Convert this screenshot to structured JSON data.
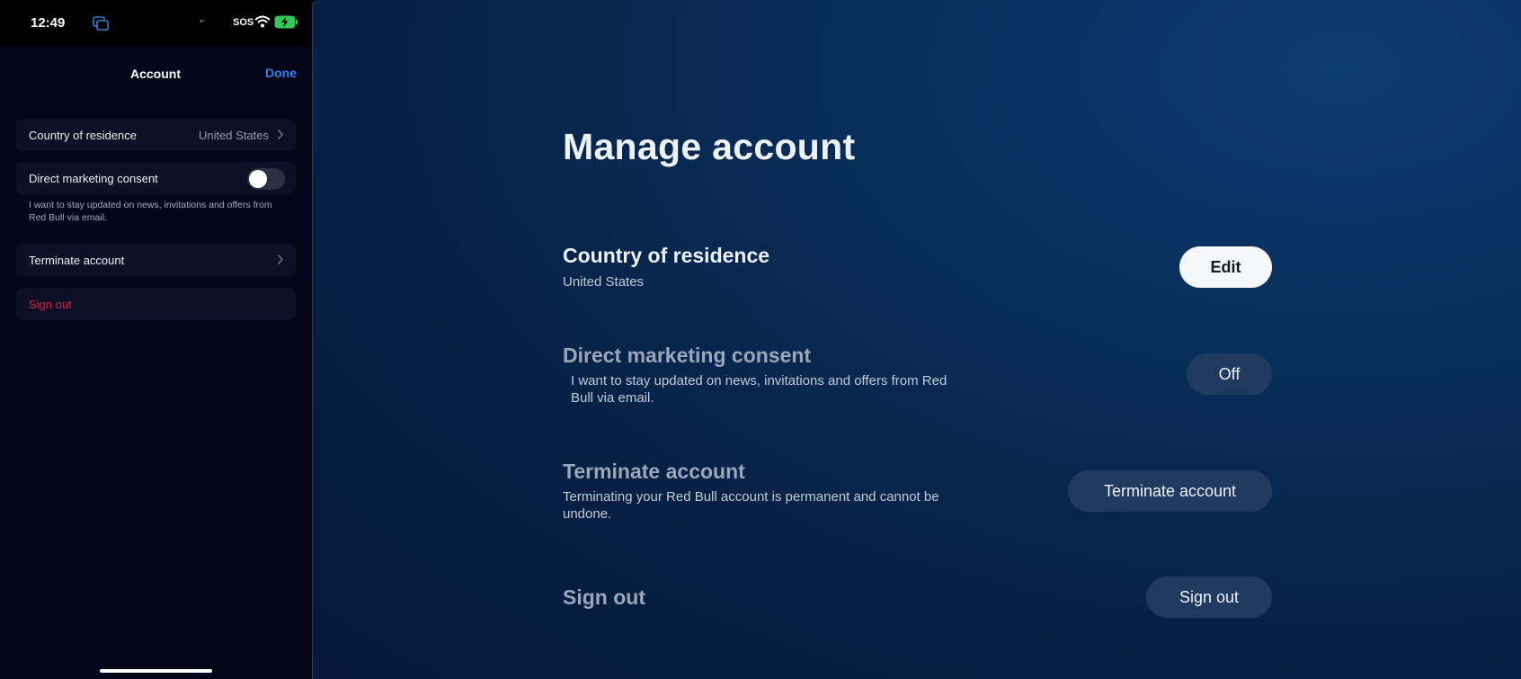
{
  "status_bar": {
    "time": "12:49",
    "carrier": "SOS"
  },
  "phone": {
    "nav": {
      "title": "Account",
      "done": "Done"
    },
    "rows": {
      "country": {
        "label": "Country of residence",
        "value": "United States"
      },
      "consent": {
        "label": "Direct marketing consent",
        "toggle_on": false,
        "description": "I want to stay updated on news, invitations and offers from Red Bull via email."
      },
      "terminate": {
        "label": "Terminate account"
      },
      "signout": {
        "label": "Sign out"
      }
    }
  },
  "web": {
    "title": "Manage account",
    "country": {
      "heading": "Country of residence",
      "value": "United States",
      "button": "Edit"
    },
    "consent": {
      "heading": "Direct marketing consent",
      "description": "I want to stay updated on news, invitations and offers from Red Bull via email.",
      "button": "Off"
    },
    "terminate": {
      "heading": "Terminate account",
      "description": "Terminating your Red Bull account is permanent and cannot be undone.",
      "button": "Terminate account"
    },
    "signout": {
      "heading": "Sign out",
      "button": "Sign out"
    }
  },
  "colors": {
    "accent": "#2f80ed",
    "danger": "#d6214a",
    "page_bg": "#082d59"
  }
}
